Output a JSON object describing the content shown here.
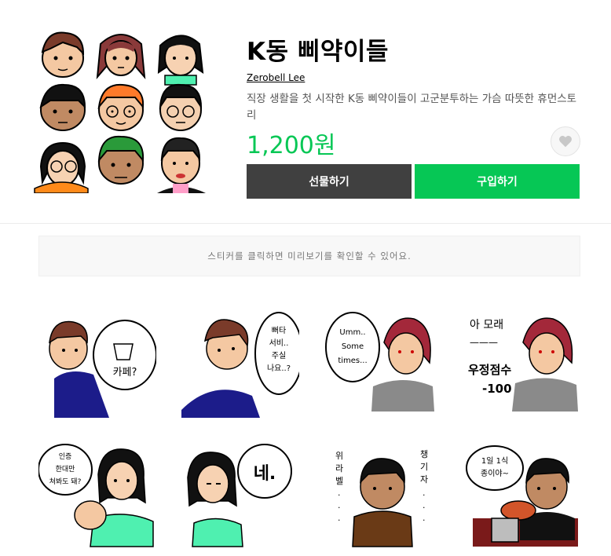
{
  "product": {
    "title": "K동 삐약이들",
    "author": "Zerobell Lee",
    "description": "직장 생활을 첫 시작한 K동 삐약이들이 고군분투하는 가슴 따뜻한 휴먼스토리",
    "price": "1,200원",
    "like_icon": "heart-icon"
  },
  "actions": {
    "gift_label": "선물하기",
    "buy_label": "구입하기"
  },
  "notice": "스티커를 클릭하면 미리보기를 확인할 수 있어요.",
  "stickers": [
    {
      "text": "카페?"
    },
    {
      "text_lines": [
        "뻐타",
        "서비..",
        "주실",
        "나요..?"
      ]
    },
    {
      "text_lines": [
        "Umm..",
        "Some",
        "times..."
      ]
    },
    {
      "text_lines": [
        "아 모래",
        "———",
        "우정점수",
        "-100"
      ]
    },
    {
      "text_lines": [
        "인증",
        "한대만",
        "쳐봐도 돼?"
      ]
    },
    {
      "text": "네."
    },
    {
      "text_lines": [
        "위",
        "라",
        "벨",
        "·",
        "·",
        "·"
      ],
      "text_lines_right": [
        "챙",
        "기",
        "자",
        "·",
        "·",
        "·"
      ]
    },
    {
      "text_lines": [
        "1일 1식",
        "종이야~"
      ]
    }
  ],
  "colors": {
    "accent": "#06c755",
    "gift_button": "#404040",
    "muted_text": "#555555"
  }
}
